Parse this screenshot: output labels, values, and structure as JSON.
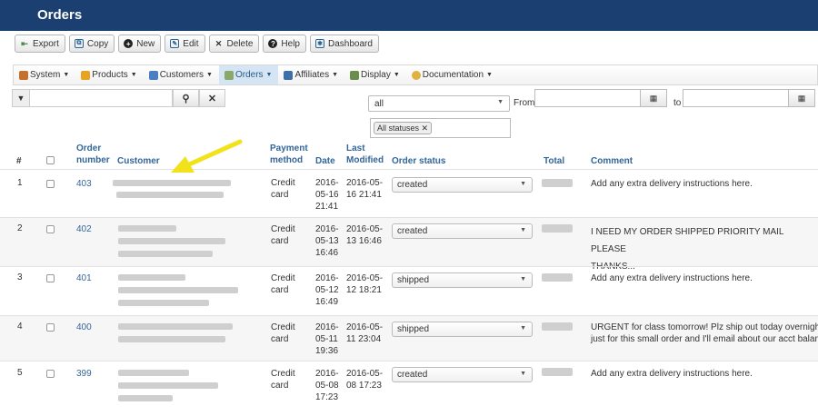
{
  "header": {
    "title": "Orders"
  },
  "toolbar": {
    "export": "Export",
    "copy": "Copy",
    "new": "New",
    "edit": "Edit",
    "delete": "Delete",
    "help": "Help",
    "dashboard": "Dashboard"
  },
  "menu": {
    "system": "System",
    "products": "Products",
    "customers": "Customers",
    "orders": "Orders",
    "affiliates": "Affiliates",
    "display": "Display",
    "documentation": "Documentation"
  },
  "filter": {
    "all_value": "all",
    "from_label": "From",
    "to_label": "to",
    "status_chip": "All statuses"
  },
  "columns": {
    "num": "#",
    "order_number_1": "Order",
    "order_number_2": "number",
    "customer": "Customer",
    "payment_1": "Payment",
    "payment_2": "method",
    "date": "Date",
    "last_modified_1": "Last",
    "last_modified_2": "Modified",
    "order_status": "Order status",
    "total": "Total",
    "comment": "Comment"
  },
  "rows": [
    {
      "num": "1",
      "order": "403",
      "pay1": "Credit",
      "pay2": "card",
      "d1": "2016-",
      "d2": "05-16",
      "d3": "21:41",
      "m1": "2016-05-",
      "m2": "16 21:41",
      "status": "created",
      "comment1": "Add any extra delivery instructions here.",
      "comment2": ""
    },
    {
      "num": "2",
      "order": "402",
      "pay1": "Credit",
      "pay2": "card",
      "d1": "2016-",
      "d2": "05-13",
      "d3": "16:46",
      "m1": "2016-05-",
      "m2": "13 16:46",
      "status": "created",
      "comment1": "I NEED MY ORDER SHIPPED PRIORITY MAIL PLEASE",
      "comment2": "THANKS..."
    },
    {
      "num": "3",
      "order": "401",
      "pay1": "Credit",
      "pay2": "card",
      "d1": "2016-",
      "d2": "05-12",
      "d3": "16:49",
      "m1": "2016-05-",
      "m2": "12 18:21",
      "status": "shipped",
      "comment1": "Add any extra delivery instructions here.",
      "comment2": ""
    },
    {
      "num": "4",
      "order": "400",
      "pay1": "Credit",
      "pay2": "card",
      "d1": "2016-",
      "d2": "05-11",
      "d3": "19:36",
      "m1": "2016-05-",
      "m2": "11 23:04",
      "status": "shipped",
      "comment1": "URGENT for class tomorrow! Plz ship out today overnight if p",
      "comment2": "just for this small order and I'll email about our acct balance."
    },
    {
      "num": "5",
      "order": "399",
      "pay1": "Credit",
      "pay2": "card",
      "d1": "2016-",
      "d2": "05-08",
      "d3": "17:23",
      "m1": "2016-05-",
      "m2": "08 17:23",
      "status": "created",
      "comment1": "Add any extra delivery instructions here.",
      "comment2": ""
    }
  ],
  "colors": {
    "header_bg": "#1c3f72",
    "link": "#336699",
    "arrow": "#f2e21c"
  }
}
